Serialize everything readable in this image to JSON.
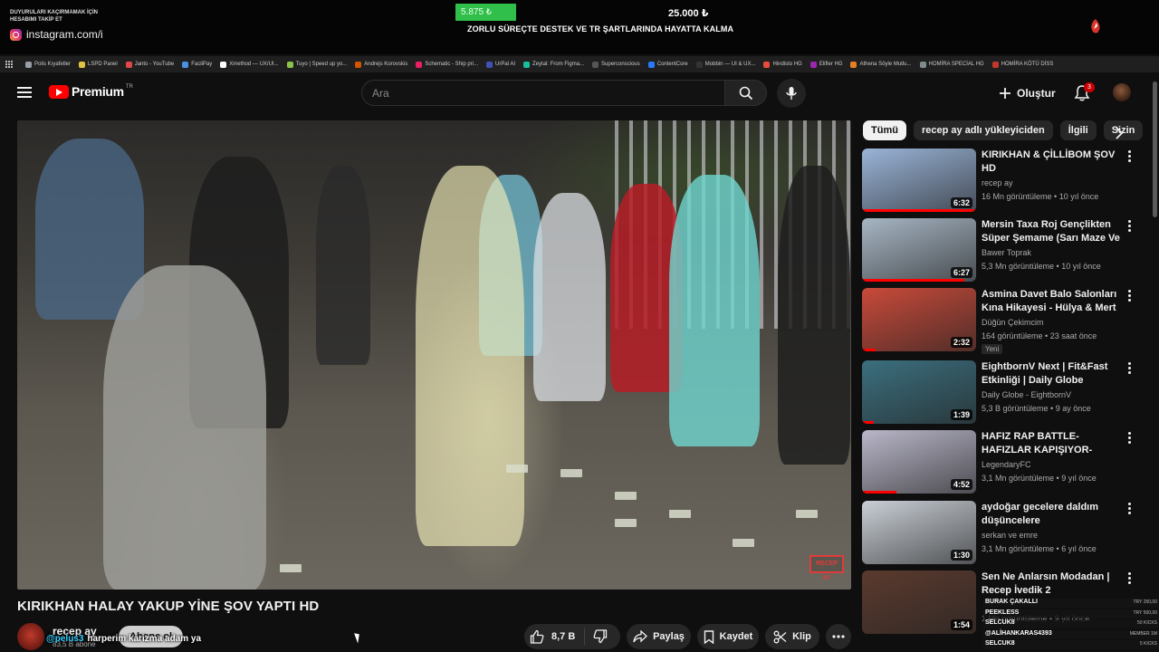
{
  "overlay": {
    "small_lines": [
      "DUYURULARI KAÇIRMAMAK İÇİN",
      "HESABIMI TAKİP ET"
    ],
    "instagram": "instagram.com/i",
    "goal_current": "5.875 ₺",
    "goal_target": "25.000 ₺",
    "goal_caption": "ZORLU SÜREÇTE DESTEK VE TR ŞARTLARINDA HAYATTA KALMA"
  },
  "bookmarks": [
    {
      "label": "Polis Kıyafetler",
      "color": "#9aa0a6"
    },
    {
      "label": "LSPD Panel",
      "color": "#e0c341"
    },
    {
      "label": "Janto - YouTube",
      "color": "#e04848"
    },
    {
      "label": "FacilPay",
      "color": "#4a90e2"
    },
    {
      "label": "Xmethod — UX/UI...",
      "color": "#ffffff"
    },
    {
      "label": "Tuyo | Speed up yo...",
      "color": "#8bc34a"
    },
    {
      "label": "Andrejs Korovskis",
      "color": "#d35400"
    },
    {
      "label": "Schematic - Ship pri...",
      "color": "#e91e63"
    },
    {
      "label": "UrPal AI",
      "color": "#3f51b5"
    },
    {
      "label": "Zeytal: From Figma...",
      "color": "#1abc9c"
    },
    {
      "label": "Superconscious",
      "color": "#555555"
    },
    {
      "label": "ContentCore",
      "color": "#2979ff"
    },
    {
      "label": "Mobbin — UI & UX...",
      "color": "#333333"
    },
    {
      "label": "Hindisto HG",
      "color": "#e74c3c"
    },
    {
      "label": "Elifler HG",
      "color": "#9c27b0"
    },
    {
      "label": "Athena Söyle Mutlu...",
      "color": "#e67e22"
    },
    {
      "label": "HOMİRA SPECİAL HG",
      "color": "#7f8c8d"
    },
    {
      "label": "HOMİRA KÖTÜ DİSS",
      "color": "#c0392b"
    }
  ],
  "header": {
    "logo_text": "Premium",
    "logo_region": "TR",
    "search_placeholder": "Ara",
    "create_label": "Oluştur",
    "notifications": "3"
  },
  "video": {
    "title": "KIRIKHAN HALAY YAKUP YİNE ŞOV YAPTI HD",
    "channel": "recep ay",
    "subs": "83,5 B abone",
    "subscribe_label": "Abone ol",
    "likes": "8,7 B",
    "share_label": "Paylaş",
    "save_label": "Kaydet",
    "clip_label": "Klip",
    "watermark": "RECEP AY",
    "chat_nick": "@pelus3",
    "chat_text": "harperim karizma adam ya"
  },
  "sidebar": {
    "chips": [
      "Tümü",
      "recep ay adlı yükleyiciden",
      "İlgili",
      "Sizin"
    ],
    "items": [
      {
        "title": "KIRIKHAN & ÇİLLİBOM ŞOV HD",
        "channel": "recep ay",
        "meta": "16 Mn görüntüleme • 10 yıl önce",
        "duration": "6:32",
        "badge": "",
        "thumb": "#9ab4d8"
      },
      {
        "title": "Mersin Taxa Roj Gençlikten Süper Şemame (Sarı Maze Ve ...",
        "channel": "Bawer Toprak",
        "meta": "5,3 Mn görüntüleme • 10 yıl önce",
        "duration": "6:27",
        "badge": "",
        "thumb": "#a7b6c4"
      },
      {
        "title": "Asmina Davet Balo Salonları Kına Hikayesi - Hülya & Mert",
        "channel": "Düğün Çekimcim",
        "meta": "164 görüntüleme • 23 saat önce",
        "duration": "2:32",
        "badge": "Yeni",
        "thumb": "#c94a3a"
      },
      {
        "title": "EightbornV Next | Fit&Fast Etkinliği | Daily Globe",
        "channel": "Daily Globe - EightbornV",
        "meta": "5,3 B görüntüleme • 9 ay önce",
        "duration": "1:39",
        "badge": "",
        "thumb": "#3b6f7e"
      },
      {
        "title": "HAFIZ RAP BATTLE-HAFIZLAR KAPIŞIYOR-HAFIZ LAF ...",
        "channel": "LegendaryFC",
        "meta": "3,1 Mn görüntüleme • 9 yıl önce",
        "duration": "4:52",
        "badge": "",
        "thumb": "#b9b7c9"
      },
      {
        "title": "aydoğar gecelere daldım düşüncelere",
        "channel": "serkan ve emre",
        "meta": "3,1 Mn görüntüleme • 6 yıl önce",
        "duration": "1:30",
        "badge": "",
        "thumb": "#c9cfd6"
      },
      {
        "title": "Sen Ne Anlarsın Modadan | Recep İvedik 2",
        "channel": "",
        "meta": "1 Mn görüntüleme • 9 yıl önce",
        "duration": "1:54",
        "badge": "",
        "thumb": "#5b3a2e"
      }
    ]
  },
  "donations": [
    {
      "name": "BURAK ÇAKALLI",
      "amount": "TRY 250,00"
    },
    {
      "name": "PEEKLESS",
      "amount": "TRY 500,00"
    },
    {
      "name": "SELCUK8",
      "amount": "50 KICKS"
    },
    {
      "name": "@ALİHANKARAS4393",
      "amount": "MEMBER 1M"
    },
    {
      "name": "SELCUK8",
      "amount": "5 KICKS"
    }
  ]
}
